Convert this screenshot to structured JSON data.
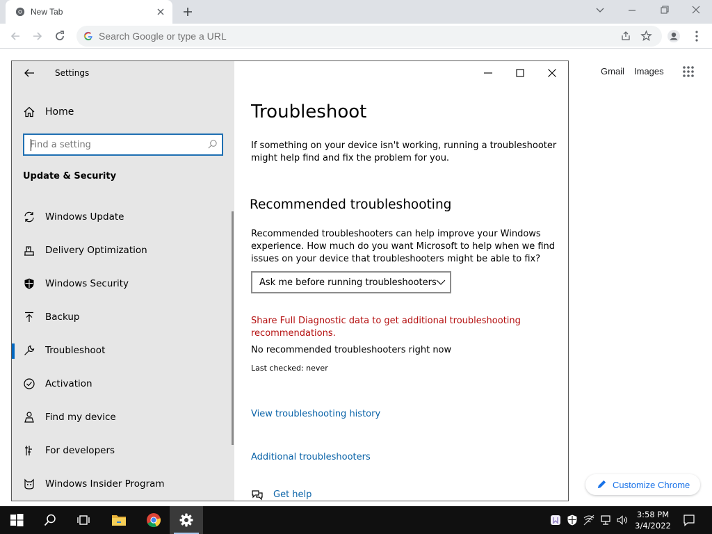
{
  "browser": {
    "tab_title": "New Tab",
    "omnibox_placeholder": "Search Google or type a URL",
    "ntp_links": {
      "gmail": "Gmail",
      "images": "Images"
    },
    "customize_label": "Customize Chrome"
  },
  "settings": {
    "app_title": "Settings",
    "home_label": "Home",
    "search_placeholder": "Find a setting",
    "section_title": "Update & Security",
    "nav_items": [
      {
        "label": "Windows Update",
        "icon": "sync-icon"
      },
      {
        "label": "Delivery Optimization",
        "icon": "delivery-icon"
      },
      {
        "label": "Windows Security",
        "icon": "shield-icon"
      },
      {
        "label": "Backup",
        "icon": "backup-arrow-icon"
      },
      {
        "label": "Troubleshoot",
        "icon": "wrench-icon",
        "selected": true
      },
      {
        "label": "Activation",
        "icon": "check-circle-icon"
      },
      {
        "label": "Find my device",
        "icon": "person-location-icon"
      },
      {
        "label": "For developers",
        "icon": "developer-icon"
      },
      {
        "label": "Windows Insider Program",
        "icon": "insider-cat-icon"
      }
    ],
    "main": {
      "title": "Troubleshoot",
      "intro": "If something on your device isn't working, running a troubleshooter might help find and fix the problem for you.",
      "recommended_heading": "Recommended troubleshooting",
      "recommended_desc": "Recommended troubleshooters can help improve your Windows experience. How much do you want Microsoft to help when we find issues on your device that troubleshooters might be able to fix?",
      "dropdown_value": "Ask me before running troubleshooters",
      "diagnostic_warning": "Share Full Diagnostic data to get additional troubleshooting recommendations.",
      "no_recommended": "No recommended troubleshooters right now",
      "last_checked": "Last checked: never",
      "history_link": "View troubleshooting history",
      "additional_link": "Additional troubleshooters",
      "get_help": "Get help"
    }
  },
  "taskbar": {
    "time": "3:58 PM",
    "date": "3/4/2022"
  },
  "colors": {
    "accent_blue": "#0067c0",
    "warning_red": "#b40f0f",
    "link_blue": "#0a63a8",
    "chrome_link": "#1a73e8"
  }
}
